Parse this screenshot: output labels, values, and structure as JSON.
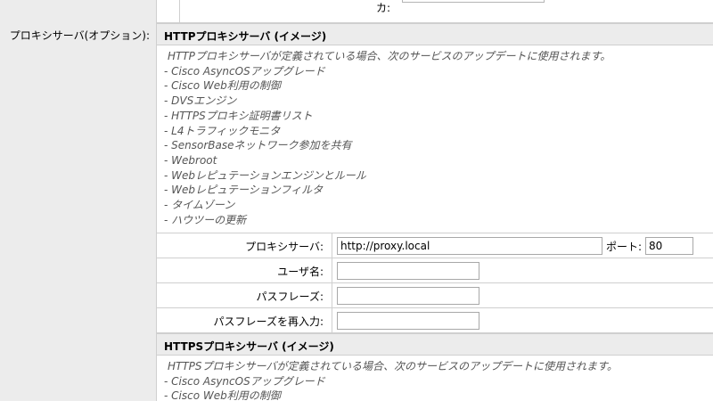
{
  "top": {
    "partial_label": "カ:"
  },
  "section_label": "プロキシサーバ(オプション):",
  "http": {
    "header": "HTTPプロキシサーバ (イメージ)",
    "intro": "HTTPプロキシサーバが定義されている場合、次のサービスのアップデートに使用されます。",
    "services": [
      "- Cisco AsyncOSアップグレード",
      "- Cisco Web利用の制御",
      "- DVSエンジン",
      "- HTTPSプロキシ証明書リスト",
      "- L4トラフィックモニタ",
      "- SensorBaseネットワーク参加を共有",
      "- Webroot",
      "- Webレピュテーションエンジンとルール",
      "- Webレピュテーションフィルタ",
      "- タイムゾーン",
      "- ハウツーの更新"
    ],
    "proxy_label": "プロキシサーバ:",
    "proxy_value": "http://proxy.local",
    "port_label": "ポート:",
    "port_value": "80",
    "user_label": "ユーザ名:",
    "user_value": "",
    "pass_label": "パスフレーズ:",
    "pass_value": "",
    "repass_label": "パスフレーズを再入力:",
    "repass_value": ""
  },
  "https": {
    "header": "HTTPSプロキシサーバ (イメージ)",
    "intro": "HTTPSプロキシサーバが定義されている場合、次のサービスのアップデートに使用されます。",
    "services": [
      "- Cisco AsyncOSアップグレード",
      "- Cisco Web利用の制御"
    ]
  }
}
